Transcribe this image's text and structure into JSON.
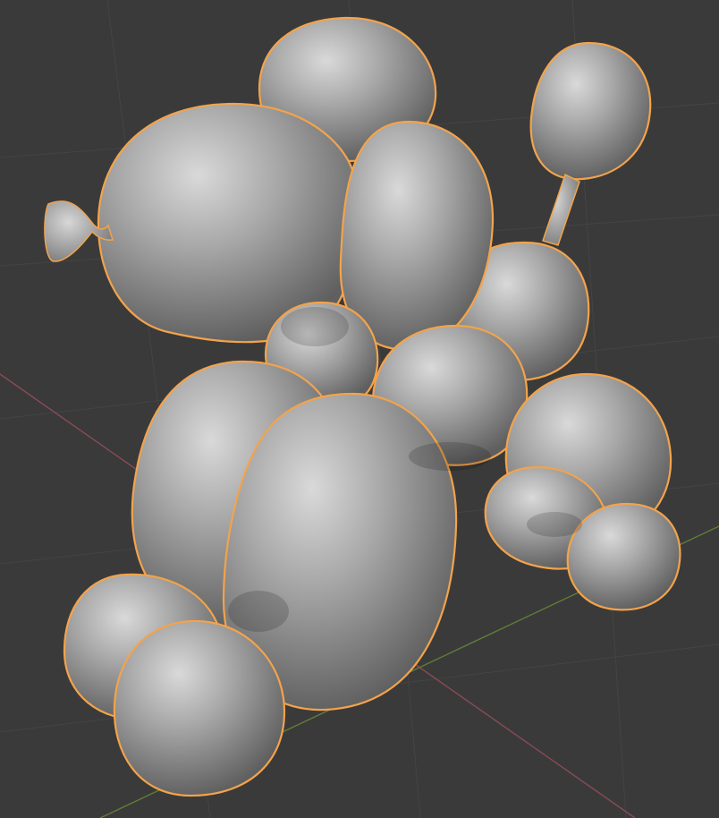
{
  "scene": {
    "colors": {
      "background": "#3a3a3a",
      "grid": "#444444",
      "x_axis": "#8a4b56",
      "y_axis": "#5f7d37",
      "selection_outline": "#f3a34b",
      "balloon_base": "#8d8d8d",
      "balloon_highlight": "#d8d8d8"
    },
    "object": "balloon-dog",
    "selected": true
  }
}
